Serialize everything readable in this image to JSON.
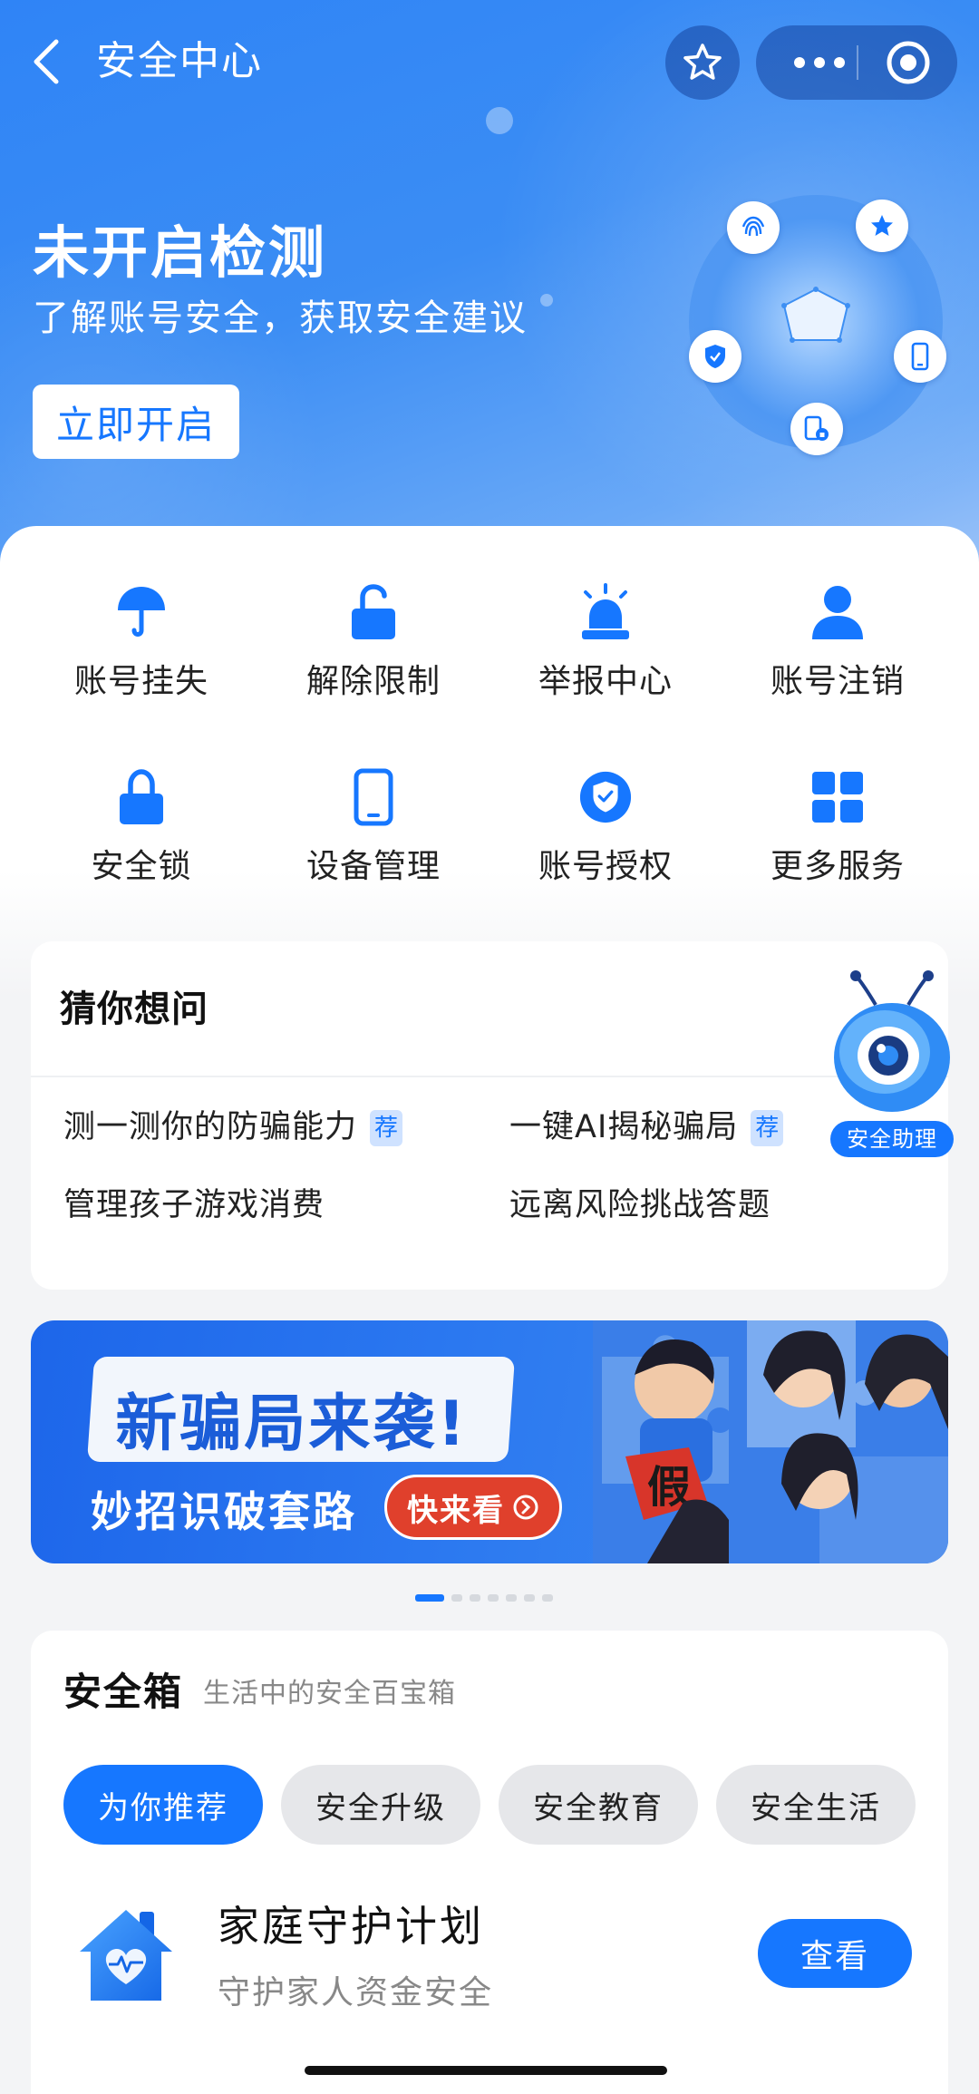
{
  "nav": {
    "title": "安全中心"
  },
  "hero": {
    "title": "未开启检测",
    "subtitle": "了解账号安全，获取安全建议",
    "button_label": "立即开启"
  },
  "services": [
    {
      "label": "账号挂失",
      "icon": "umbrella-icon"
    },
    {
      "label": "解除限制",
      "icon": "unlock-icon"
    },
    {
      "label": "举报中心",
      "icon": "alarm-icon"
    },
    {
      "label": "账号注销",
      "icon": "user-icon"
    },
    {
      "label": "安全锁",
      "icon": "lock-icon"
    },
    {
      "label": "设备管理",
      "icon": "phone-icon"
    },
    {
      "label": "账号授权",
      "icon": "shield-check-icon"
    },
    {
      "label": "更多服务",
      "icon": "grid-icon"
    }
  ],
  "guess": {
    "title": "猜你想问",
    "questions": [
      {
        "text": "测一测你的防骗能力",
        "badge": "荐"
      },
      {
        "text": "一键AI揭秘骗局",
        "badge": "荐"
      },
      {
        "text": "管理孩子游戏消费",
        "badge": ""
      },
      {
        "text": "远离风险挑战答题",
        "badge": ""
      }
    ],
    "assistant_label": "安全助理"
  },
  "banner": {
    "headline": "新骗局来袭!",
    "subline": "妙招识破套路",
    "button_label": "快来看",
    "badge_char": "假",
    "page_count": 7,
    "active_page": 1
  },
  "safebox": {
    "title": "安全箱",
    "subtitle": "生活中的安全百宝箱",
    "tabs": [
      "为你推荐",
      "安全升级",
      "安全教育",
      "安全生活"
    ],
    "active_tab": 0,
    "item": {
      "title": "家庭守护计划",
      "subtitle": "守护家人资金安全",
      "button_label": "查看"
    }
  },
  "colors": {
    "accent": "#1677ff",
    "hero_blue": "#2f84f6",
    "banner_red": "#e0402c"
  }
}
